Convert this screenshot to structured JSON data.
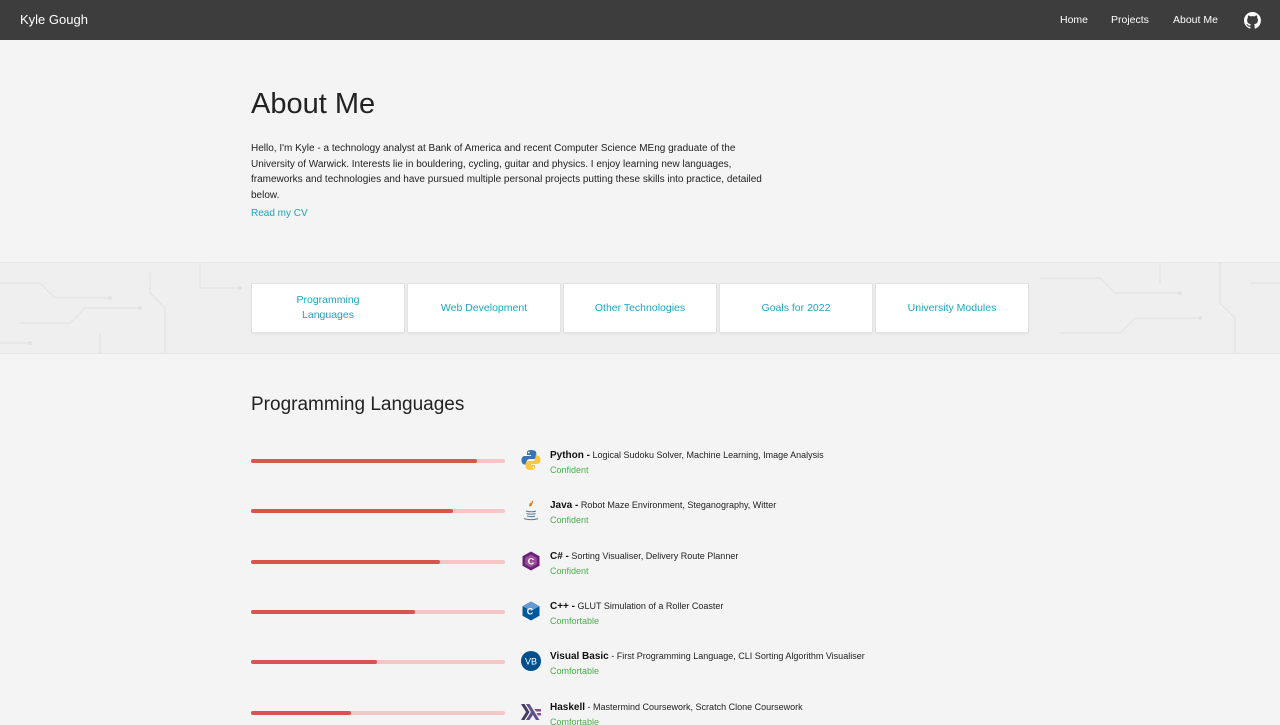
{
  "navbar": {
    "brand": "Kyle Gough",
    "links": [
      "Home",
      "Projects",
      "About Me"
    ]
  },
  "about": {
    "title": "About Me",
    "intro": "Hello, I'm Kyle - a technology analyst at Bank of America and recent Computer Science MEng graduate of the University of Warwick. Interests lie in bouldering, cycling, guitar and physics. I enjoy learning new languages, frameworks and technologies and have pursued multiple personal projects putting these skills into practice, detailed below.",
    "cv_link": "Read my CV"
  },
  "tabs": [
    "Programming Languages",
    "Web Development",
    "Other Technologies",
    "Goals for 2022",
    "University Modules"
  ],
  "section": {
    "title": "Programming Languages",
    "languages": [
      {
        "name": "Python -",
        "projects": " Logical Sudoku Solver, Machine Learning, Image Analysis",
        "level": "Confident",
        "proficiency": 0.89,
        "icon": "python-icon"
      },
      {
        "name": "Java -",
        "projects": " Robot Maze Environment, Steganography, Witter",
        "level": "Confident",
        "proficiency": 0.795,
        "icon": "java-icon"
      },
      {
        "name": "C# -",
        "projects": " Sorting Visualiser, Delivery Route Planner",
        "level": "Confident",
        "proficiency": 0.745,
        "icon": "csharp-icon"
      },
      {
        "name": "C++ -",
        "projects": " GLUT Simulation of a Roller Coaster",
        "level": "Comfortable",
        "proficiency": 0.645,
        "icon": "cpp-icon"
      },
      {
        "name": "Visual Basic",
        "projects": " - First Programming Language, CLI Sorting Algorithm Visualiser",
        "level": "Comfortable",
        "proficiency": 0.495,
        "icon": "visual-basic-icon"
      },
      {
        "name": "Haskell",
        "projects": " - Mastermind Coursework, Scratch Clone Coursework",
        "level": "Comfortable",
        "proficiency": 0.395,
        "icon": "haskell-icon"
      }
    ]
  },
  "colors": {
    "navbar": "#3d3d3d",
    "accent": "#1aa7c2",
    "bar_fill": "#d9534f",
    "bar_track": "#f6c6c6",
    "level_text": "#4cae4c"
  }
}
